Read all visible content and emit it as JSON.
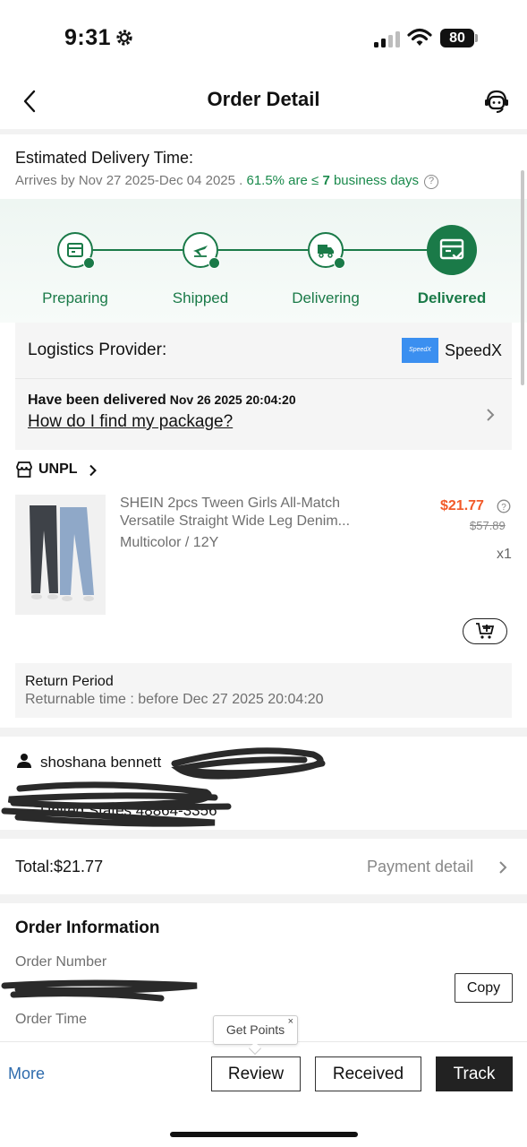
{
  "status_bar": {
    "time": "9:31",
    "battery": "80"
  },
  "header": {
    "title": "Order Detail"
  },
  "delivery": {
    "title": "Estimated Delivery Time:",
    "arrives": "Arrives by Nov 27 2025-Dec 04 2025 .",
    "stat": "61.5% are ≤",
    "days": "7",
    "days_suffix": "business days"
  },
  "tracker": {
    "accent": "#1a7a48",
    "steps": [
      {
        "label": "Preparing",
        "done": true
      },
      {
        "label": "Shipped",
        "done": true
      },
      {
        "label": "Delivering",
        "done": true
      },
      {
        "label": "Delivered",
        "active": true
      }
    ]
  },
  "logistics": {
    "label": "Logistics Provider:",
    "provider_logo_text": "SpeedX",
    "provider": "SpeedX",
    "status": "Have been delivered",
    "status_time": "Nov 26 2025 20:04:20",
    "link": "How do I find my package?"
  },
  "store": {
    "name": "UNPL"
  },
  "product": {
    "title": "SHEIN 2pcs Tween Girls All-Match Versatile Straight Wide Leg Denim...",
    "variant": "Multicolor / 12Y",
    "price": "$21.77",
    "original_price": "$57.89",
    "quantity": "x1"
  },
  "return": {
    "title": "Return Period",
    "time": "Returnable time : before  Dec 27 2025 20:04:20"
  },
  "address": {
    "name": "shoshana bennett",
    "line": "United States 48864-3356"
  },
  "total": {
    "label": "Total:$21.77",
    "payment_detail": "Payment detail"
  },
  "order_info": {
    "title": "Order Information",
    "number_label": "Order Number",
    "copy": "Copy",
    "time_label": "Order Time"
  },
  "bottom": {
    "more": "More",
    "tooltip": "Get Points",
    "tooltip_close": "×",
    "review": "Review",
    "received": "Received",
    "track": "Track"
  }
}
